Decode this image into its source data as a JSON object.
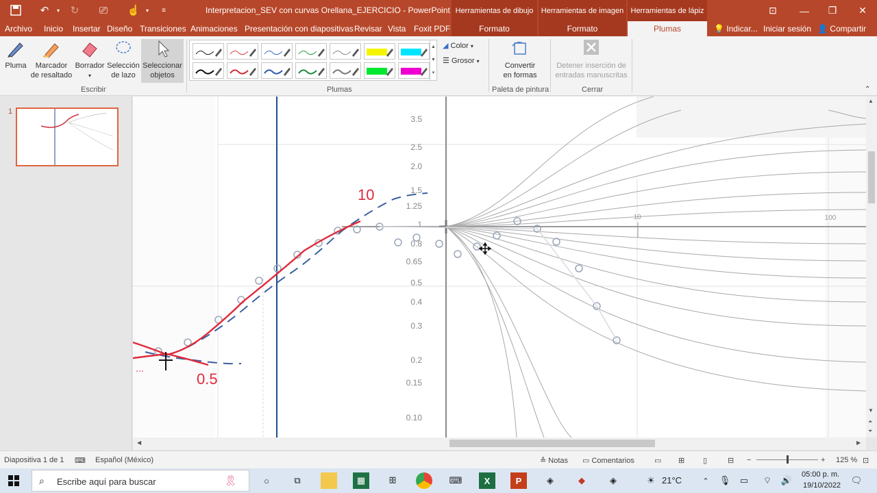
{
  "window": {
    "title": "Interpretacion_SEV con curvas Orellana_EJERCICIO - PowerPoint",
    "context_groups": [
      "Herramientas de dibujo",
      "Herramientas de imagen",
      "Herramientas de lápiz"
    ]
  },
  "tabs": [
    "Archivo",
    "Inicio",
    "Insertar",
    "Diseño",
    "Transiciones",
    "Animaciones",
    "Presentación con diapositivas",
    "Revisar",
    "Vista",
    "Foxit PDF"
  ],
  "context_tabs": [
    "Formato",
    "Formato",
    "Plumas"
  ],
  "tell_me": "Indicar...",
  "signin": "Iniciar sesión",
  "share": "Compartir",
  "ribbon": {
    "escribir": {
      "label": "Escribir",
      "pluma": "Pluma",
      "marcador_1": "Marcador",
      "marcador_2": "de resaltado",
      "borrador": "Borrador",
      "seleccion_1": "Selección",
      "seleccion_2": "de lazo",
      "seleccionar_1": "Seleccionar",
      "seleccionar_2": "objetos"
    },
    "plumas": {
      "label": "Plumas",
      "pens_row1": [
        "#222222",
        "#e0404a",
        "#3a70c0",
        "#2a9a4a",
        "#888888",
        "#f5f500",
        "#00e5ff"
      ],
      "pens_row2": [
        "#111111",
        "#d42a3a",
        "#2a5ab0",
        "#1f8a3c",
        "#777777",
        "#00e830",
        "#f000d0"
      ],
      "color": "Color",
      "grosor": "Grosor"
    },
    "paleta": {
      "label": "Paleta de pintura",
      "convertir_1": "Convertir",
      "convertir_2": "en formas"
    },
    "cerrar": {
      "label": "Cerrar",
      "detener_1": "Detener inserción de",
      "detener_2": "entradas manuscritas"
    }
  },
  "thumbnail": {
    "number": "1"
  },
  "slide": {
    "y_ticks": [
      "3.5",
      "2.5",
      "2.0",
      "1.5",
      "1.25",
      "1",
      "0.8",
      "0.65",
      "0.5",
      "0.4",
      "0.3",
      "0.2",
      "0.15",
      "0.10"
    ],
    "x_ticks": [
      "10",
      "100"
    ],
    "annotations": [
      "10",
      "0.5"
    ]
  },
  "status": {
    "slide": "Diapositiva 1 de 1",
    "language": "Español (México)",
    "notes": "Notas",
    "comments": "Comentarios",
    "zoom": "125 %"
  },
  "taskbar": {
    "search_placeholder": "Escribe aquí para buscar",
    "weather": "21°C",
    "time": "05:00 p. m.",
    "date": "19/10/2022"
  }
}
